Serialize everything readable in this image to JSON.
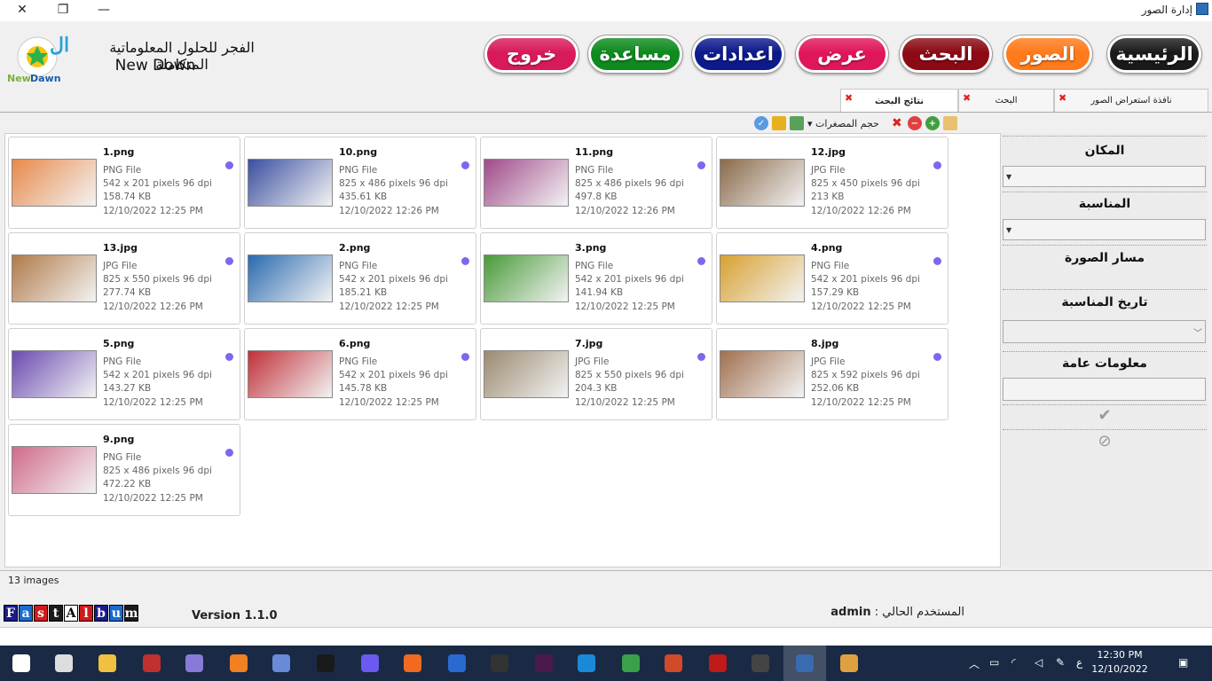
{
  "window": {
    "title": "إدارة الصور"
  },
  "header": {
    "company_ar": "الفجر للحلول المعلوماتية المتكاملة",
    "company_en": "New Down",
    "logo_text": "NewDawn",
    "nav": [
      {
        "label": "الرئيسية",
        "color": "#1a1a1a"
      },
      {
        "label": "الصور",
        "color": "#ff7a1a"
      },
      {
        "label": "البحث",
        "color": "#8b0a14"
      },
      {
        "label": "عرض",
        "color": "#e0165a"
      },
      {
        "label": "اعدادات",
        "color": "#0d1a8c"
      },
      {
        "label": "مساعدة",
        "color": "#0e8a1e"
      },
      {
        "label": "خروج",
        "color": "#d81a5a"
      }
    ]
  },
  "tabs": [
    {
      "label": "نافذة استعراض الصور"
    },
    {
      "label": "البحث"
    },
    {
      "label": "نتائج البحث"
    }
  ],
  "toolbar": {
    "thumb_size": "حجم المصغرات"
  },
  "images": [
    {
      "name": "1.png",
      "type": "PNG File",
      "dims": "542 x 201 pixels 96 dpi",
      "size": "158.74 KB",
      "date": "12/10/2022 12:25 PM",
      "thumb": "#e8894a"
    },
    {
      "name": "10.png",
      "type": "PNG File",
      "dims": "825 x 486 pixels 96 dpi",
      "size": "435.61 KB",
      "date": "12/10/2022 12:26 PM",
      "thumb": "#3a4fa0"
    },
    {
      "name": "11.png",
      "type": "PNG File",
      "dims": "825 x 486 pixels 96 dpi",
      "size": "497.8 KB",
      "date": "12/10/2022 12:26 PM",
      "thumb": "#a04a8a"
    },
    {
      "name": "12.jpg",
      "type": "JPG File",
      "dims": "825 x 450 pixels 96 dpi",
      "size": "213 KB",
      "date": "12/10/2022 12:26 PM",
      "thumb": "#8a6a4a"
    },
    {
      "name": "13.jpg",
      "type": "JPG File",
      "dims": "825 x 550 pixels 96 dpi",
      "size": "277.74 KB",
      "date": "12/10/2022 12:26 PM",
      "thumb": "#b07a4a"
    },
    {
      "name": "2.png",
      "type": "PNG File",
      "dims": "542 x 201 pixels 96 dpi",
      "size": "185.21 KB",
      "date": "12/10/2022 12:25 PM",
      "thumb": "#2a6ab0"
    },
    {
      "name": "3.png",
      "type": "PNG File",
      "dims": "542 x 201 pixels 96 dpi",
      "size": "141.94 KB",
      "date": "12/10/2022 12:25 PM",
      "thumb": "#4a9a3a"
    },
    {
      "name": "4.png",
      "type": "PNG File",
      "dims": "542 x 201 pixels 96 dpi",
      "size": "157.29 KB",
      "date": "12/10/2022 12:25 PM",
      "thumb": "#d8a030"
    },
    {
      "name": "5.png",
      "type": "PNG File",
      "dims": "542 x 201 pixels 96 dpi",
      "size": "143.27 KB",
      "date": "12/10/2022 12:25 PM",
      "thumb": "#6a4ab0"
    },
    {
      "name": "6.png",
      "type": "PNG File",
      "dims": "542 x 201 pixels 96 dpi",
      "size": "145.78 KB",
      "date": "12/10/2022 12:25 PM",
      "thumb": "#c0303a"
    },
    {
      "name": "7.jpg",
      "type": "JPG File",
      "dims": "825 x 550 pixels 96 dpi",
      "size": "204.3 KB",
      "date": "12/10/2022 12:25 PM",
      "thumb": "#9a8a70"
    },
    {
      "name": "8.jpg",
      "type": "JPG File",
      "dims": "825 x 592 pixels 96 dpi",
      "size": "252.06 KB",
      "date": "12/10/2022 12:25 PM",
      "thumb": "#a07050"
    },
    {
      "name": "9.png",
      "type": "PNG File",
      "dims": "825 x 486 pixels 96 dpi",
      "size": "472.22 KB",
      "date": "12/10/2022 12:25 PM",
      "thumb": "#d06a8a"
    }
  ],
  "status": {
    "count": "13 images"
  },
  "side_panel": {
    "place": "المكان",
    "occasion": "المناسبة",
    "image_path": "مسار الصورة",
    "occasion_date": "تاريخ المناسبة",
    "general_info": "معلومات عامة"
  },
  "footer": {
    "fastalbum": [
      "F",
      "a",
      "s",
      "t",
      "A",
      "l",
      "b",
      "u",
      "m"
    ],
    "version": "Version 1.1.0",
    "current_user_label": "المستخدم الحالي :",
    "current_user": "admin"
  },
  "taskbar": {
    "time": "12:30 PM",
    "date": "12/10/2022",
    "lang": "ع"
  }
}
